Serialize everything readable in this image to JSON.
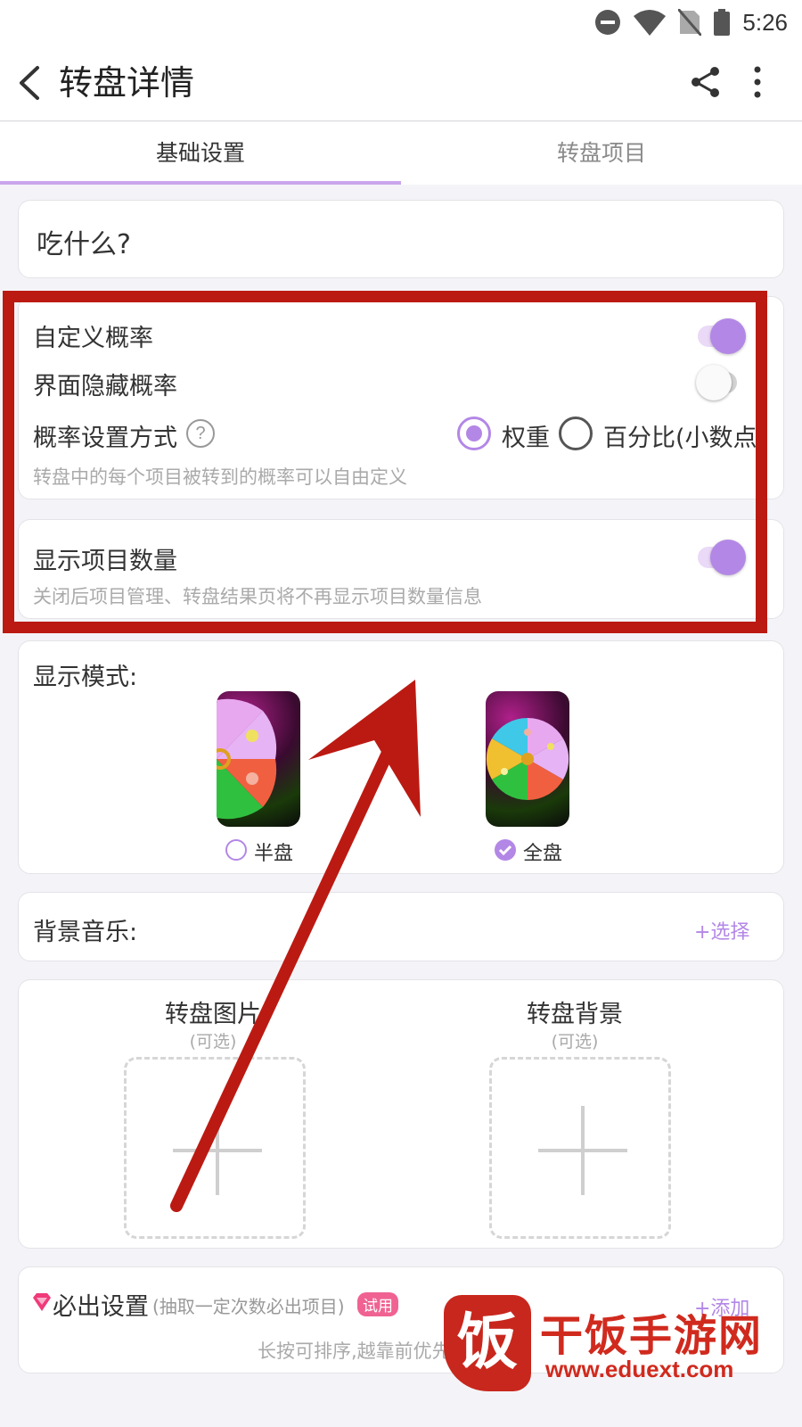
{
  "status_bar": {
    "time": "5:26"
  },
  "app_bar": {
    "title": "转盘详情"
  },
  "tabs": [
    {
      "label": "基础设置",
      "active": true
    },
    {
      "label": "转盘项目",
      "active": false
    }
  ],
  "name_card": {
    "value": "吃什么?"
  },
  "probability": {
    "custom_label": "自定义概率",
    "custom_on": true,
    "hide_label": "界面隐藏概率",
    "hide_on": false,
    "method_label": "概率设置方式",
    "option_weight": "权重",
    "option_percent": "百分比(小数点)",
    "selected": "权重",
    "hint": "转盘中的每个项目被转到的概率可以自由定义"
  },
  "count_setting": {
    "label": "显示项目数量",
    "on": true,
    "hint": "关闭后项目管理、转盘结果页将不再显示项目数量信息"
  },
  "display_mode": {
    "title": "显示模式:",
    "options": [
      {
        "label": "半盘",
        "selected": false
      },
      {
        "label": "全盘",
        "selected": true
      }
    ]
  },
  "music": {
    "label": "背景音乐:",
    "action": "+选择"
  },
  "images": {
    "wheel_image": {
      "title": "转盘图片",
      "sub": "(可选)"
    },
    "wheel_bg": {
      "title": "转盘背景",
      "sub": "(可选)"
    }
  },
  "must_win": {
    "title": "必出设置",
    "desc": "(抽取一定次数必出项目)",
    "badge": "试用",
    "action": "+添加",
    "hint": "长按可排序,越靠前优先级越高"
  },
  "watermark": {
    "brand_char": "饭",
    "name": "干饭手游网",
    "url": "www.eduext.com"
  },
  "colors": {
    "accent": "#b387e6",
    "highlight": "#bb1a12"
  }
}
